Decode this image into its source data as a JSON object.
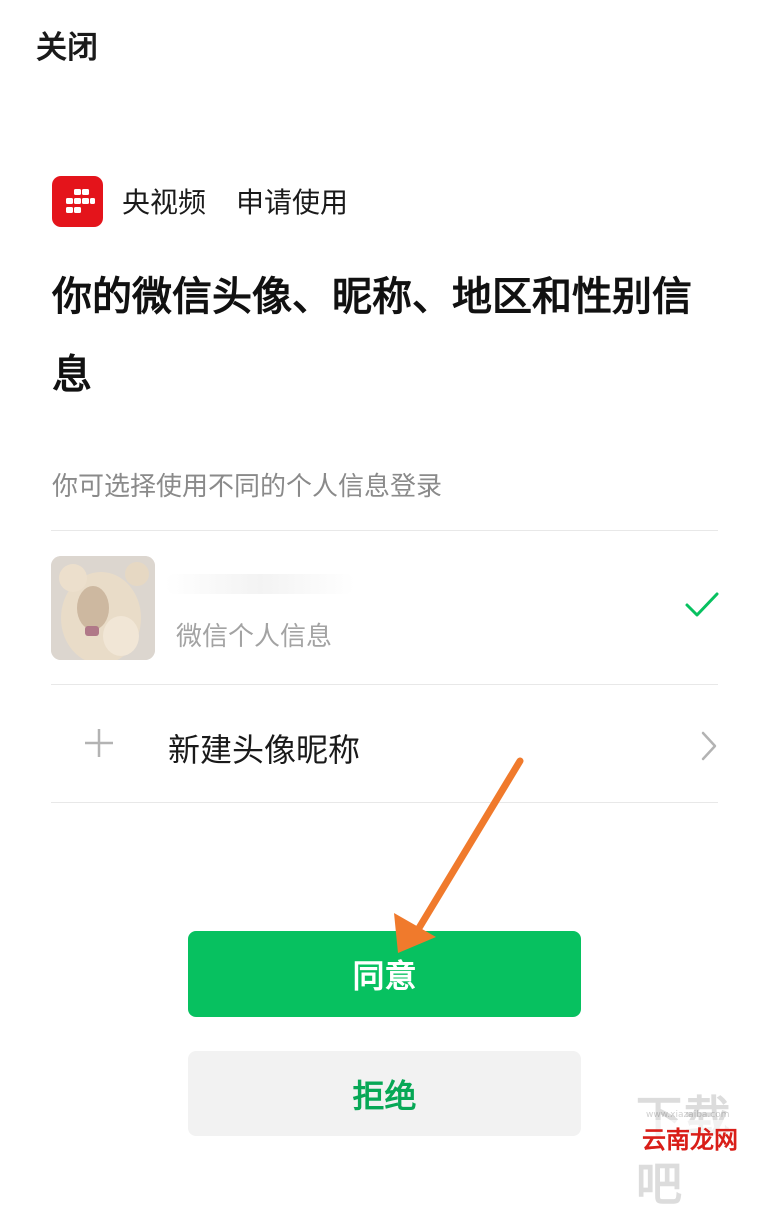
{
  "header": {
    "close_label": "关闭"
  },
  "app": {
    "name": "央视频",
    "action": "申请使用",
    "brand_color": "#e4141b",
    "logo_icon": "cctv-video-logo-icon"
  },
  "permission": {
    "title": "你的微信头像、昵称、地区和性别信息"
  },
  "profiles": {
    "hint": "你可选择使用不同的个人信息登录",
    "current": {
      "subtitle": "微信个人信息",
      "selected": true,
      "check_color": "#07c160"
    },
    "new_profile": {
      "label": "新建头像昵称"
    }
  },
  "actions": {
    "agree_label": "同意",
    "deny_label": "拒绝",
    "accent_color": "#07c160"
  },
  "watermark": {
    "big": "下载吧",
    "url": "www.xiazaiba.com",
    "site": "云南龙网"
  }
}
